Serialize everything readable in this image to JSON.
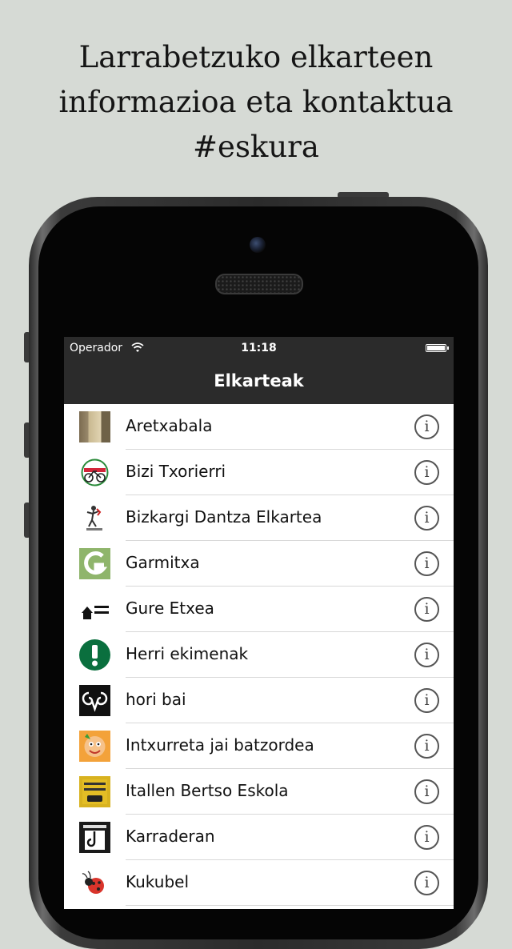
{
  "headline": {
    "line1": "Larrabetzuko elkarteen",
    "line2": "informazioa eta kontaktua",
    "line3": "#eskura"
  },
  "status_bar": {
    "carrier": "Operador",
    "time": "11:18"
  },
  "nav": {
    "title": "Elkarteak"
  },
  "list": {
    "items": [
      {
        "label": "Aretxabala"
      },
      {
        "label": "Bizi Txorierri"
      },
      {
        "label": "Bizkargi Dantza Elkartea"
      },
      {
        "label": "Garmitxa"
      },
      {
        "label": "Gure Etxea"
      },
      {
        "label": "Herri ekimenak"
      },
      {
        "label": "hori bai"
      },
      {
        "label": "Intxurreta jai batzordea"
      },
      {
        "label": "Itallen Bertso Eskola"
      },
      {
        "label": "Karraderan"
      },
      {
        "label": "Kukubel"
      }
    ]
  },
  "colors": {
    "background": "#d6dad5",
    "bar": "#2b2b2b"
  }
}
